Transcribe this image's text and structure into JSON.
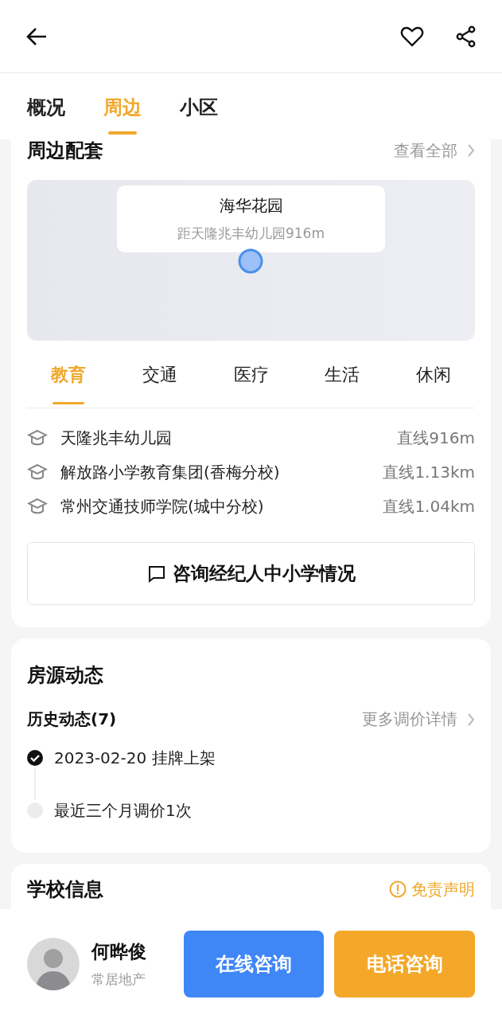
{
  "tabs": [
    {
      "label": "概况",
      "selected": false
    },
    {
      "label": "周边",
      "selected": true
    },
    {
      "label": "小区",
      "selected": false
    }
  ],
  "nearby": {
    "title": "周边配套",
    "view_all": "查看全部",
    "map": {
      "place": "海华花园",
      "distance": "距天隆兆丰幼儿园916m"
    },
    "categories": [
      {
        "label": "教育",
        "selected": true
      },
      {
        "label": "交通",
        "selected": false
      },
      {
        "label": "医疗",
        "selected": false
      },
      {
        "label": "生活",
        "selected": false
      },
      {
        "label": "休闲",
        "selected": false
      }
    ],
    "places": [
      {
        "name": "天隆兆丰幼儿园",
        "distance": "直线916m"
      },
      {
        "name": "解放路小学教育集团(香梅分校)",
        "distance": "直线1.13km"
      },
      {
        "name": "常州交通技师学院(城中分校)",
        "distance": "直线1.04km"
      }
    ],
    "consult_button": "咨询经纪人中小学情况"
  },
  "listing_updates": {
    "title": "房源动态",
    "history_title": "历史动态(7)",
    "more_link": "更多调价详情",
    "timeline": [
      {
        "text": "2023-02-20 挂牌上架",
        "done": true
      },
      {
        "text": "最近三个月调价1次",
        "done": false
      }
    ]
  },
  "school_info": {
    "title": "学校信息",
    "disclaimer": "免责声明"
  },
  "agent": {
    "name": "何晔俊",
    "company": "常居地产"
  },
  "buttons": [
    {
      "label": "在线咨询",
      "kind": "online"
    },
    {
      "label": "电话咨询",
      "kind": "phone"
    }
  ]
}
